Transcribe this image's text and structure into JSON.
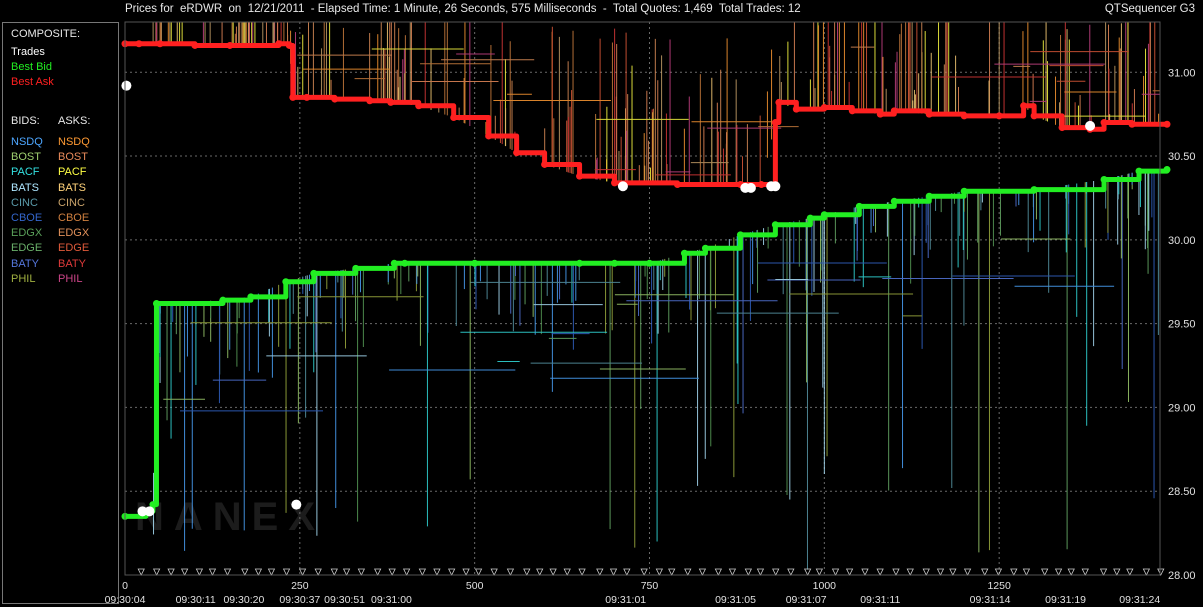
{
  "header": {
    "title": "Prices for  eRDWR  on  12/21/2011  - Elapsed Time: 1 Minute, 26 Seconds, 575 Milliseconds  -  Total Quotes: 1,469  Total Trades: 12",
    "app_name": "QTSequencer G3"
  },
  "legend": {
    "composite_heading": "COMPOSITE:",
    "composite_items": [
      {
        "label": "Trades",
        "color": "#ffffff"
      },
      {
        "label": "Best Bid",
        "color": "#22ee22"
      },
      {
        "label": "Best Ask",
        "color": "#ff2020"
      }
    ],
    "bids_heading": "BIDS:",
    "asks_heading": "ASKS:",
    "exchanges": [
      {
        "label": "NSDQ",
        "bid_color": "#4da6ff",
        "ask_color": "#ff9a33"
      },
      {
        "label": "BOST",
        "bid_color": "#9fcf6f",
        "ask_color": "#e88a5a"
      },
      {
        "label": "PACF",
        "bid_color": "#33e0e0",
        "ask_color": "#ffff44"
      },
      {
        "label": "BATS",
        "bid_color": "#aee6ff",
        "ask_color": "#ffd27a"
      },
      {
        "label": "CINC",
        "bid_color": "#5a9aaa",
        "ask_color": "#c9a36a"
      },
      {
        "label": "CBOE",
        "bid_color": "#3366cc",
        "ask_color": "#d08040"
      },
      {
        "label": "EDGX",
        "bid_color": "#5aa05a",
        "ask_color": "#e0905a"
      },
      {
        "label": "EDGE",
        "bid_color": "#6ab06a",
        "ask_color": "#e05a3a"
      },
      {
        "label": "BATY",
        "bid_color": "#5577dd",
        "ask_color": "#e03a3a"
      },
      {
        "label": "PHIL",
        "bid_color": "#a0b040",
        "ask_color": "#cc4488"
      }
    ]
  },
  "watermark": "NANEX",
  "chart_data": {
    "type": "line",
    "ylim": [
      28.0,
      31.3
    ],
    "xlim": [
      0,
      1480
    ],
    "y_ticks": [
      "28.00",
      "28.50",
      "29.00",
      "29.50",
      "30.00",
      "30.50",
      "31.00"
    ],
    "y_tick_values": [
      28.0,
      28.5,
      29.0,
      29.5,
      30.0,
      30.5,
      31.0
    ],
    "x_ticks": [
      "0",
      "250",
      "500",
      "750",
      "1000",
      "1250"
    ],
    "x_tick_values": [
      0,
      250,
      500,
      750,
      1000,
      1250
    ],
    "time_labels": [
      "09:30:04",
      "09:30:11",
      "09:30:20",
      "09:30:37",
      "09:30:51",
      "09:31:00",
      "09:31:01",
      "09:31:05",
      "09:31:07",
      "09:31:11",
      "09:31:14",
      "09:31:19",
      "09:31:24"
    ],
    "time_label_x": [
      0,
      101,
      170,
      250,
      314,
      381,
      716,
      873,
      974,
      1080,
      1237,
      1345,
      1451
    ],
    "grid": true,
    "series": [
      {
        "name": "Best Ask",
        "color": "#ff2020",
        "x": [
          0,
          20,
          50,
          100,
          150,
          220,
          235,
          240,
          260,
          300,
          350,
          380,
          420,
          470,
          520,
          560,
          600,
          650,
          700,
          790,
          880,
          910,
          930,
          935,
          960,
          1000,
          1040,
          1080,
          1100,
          1150,
          1200,
          1250,
          1285,
          1300,
          1340,
          1380,
          1400,
          1440,
          1490
        ],
        "y": [
          31.17,
          31.17,
          31.17,
          31.16,
          31.16,
          31.17,
          31.16,
          30.85,
          30.85,
          30.84,
          30.83,
          30.82,
          30.8,
          30.73,
          30.62,
          30.52,
          30.45,
          30.38,
          30.34,
          30.33,
          30.33,
          30.33,
          30.7,
          30.82,
          30.78,
          30.79,
          30.77,
          30.75,
          30.77,
          30.75,
          30.74,
          30.74,
          30.8,
          30.74,
          30.67,
          30.66,
          30.7,
          30.69,
          30.69
        ]
      },
      {
        "name": "Best Bid",
        "color": "#22ee22",
        "x": [
          0,
          30,
          40,
          45,
          140,
          180,
          230,
          270,
          330,
          385,
          400,
          500,
          650,
          700,
          750,
          800,
          830,
          880,
          930,
          980,
          1000,
          1050,
          1100,
          1150,
          1200,
          1300,
          1400,
          1450,
          1490
        ],
        "y": [
          28.35,
          28.38,
          28.42,
          29.62,
          29.64,
          29.66,
          29.75,
          29.8,
          29.83,
          29.86,
          29.86,
          29.86,
          29.86,
          29.86,
          29.86,
          29.92,
          29.95,
          30.03,
          30.09,
          30.13,
          30.15,
          30.2,
          30.23,
          30.26,
          30.29,
          30.3,
          30.36,
          30.41,
          30.42
        ]
      },
      {
        "name": "Trades",
        "color": "#ffffff",
        "x": [
          2,
          25,
          35,
          245,
          712,
          887,
          895,
          924,
          930,
          1380
        ],
        "y": [
          30.92,
          28.38,
          28.38,
          28.42,
          30.32,
          30.31,
          30.31,
          30.32,
          30.32,
          30.68
        ]
      }
    ]
  }
}
